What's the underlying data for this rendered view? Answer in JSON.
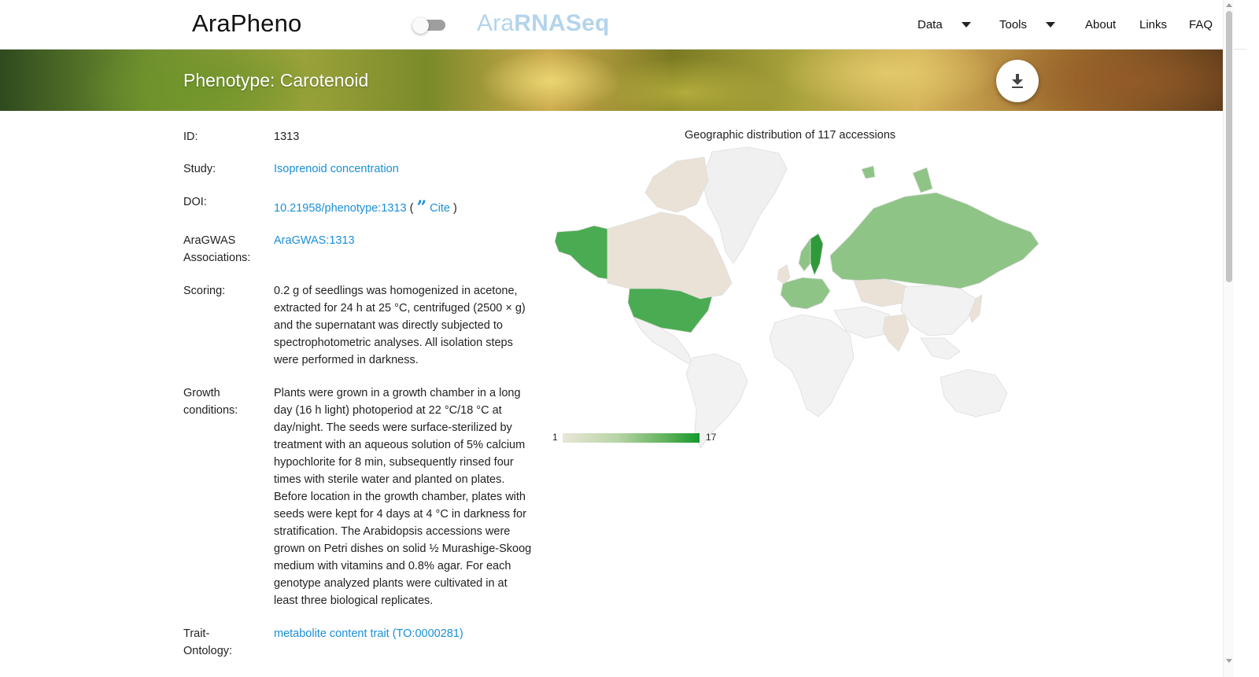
{
  "header": {
    "brand": "AraPheno",
    "rnaseq_a": "Ara",
    "rnaseq_b": "RNASeq",
    "nav": [
      {
        "label": "Data",
        "dropdown": true
      },
      {
        "label": "Tools",
        "dropdown": true
      },
      {
        "label": "About"
      },
      {
        "label": "Links"
      },
      {
        "label": "FAQ"
      }
    ]
  },
  "banner": {
    "title": "Phenotype: Carotenoid",
    "download_icon": "download-icon"
  },
  "details": {
    "id_label": "ID:",
    "id_value": "1313",
    "study_label": "Study:",
    "study_value": "Isoprenoid concentration",
    "doi_label": "DOI:",
    "doi_value": "10.21958/phenotype:1313",
    "doi_open": "(",
    "doi_cite": "Cite",
    "doi_close": ")",
    "aragwas_label": "AraGWAS Associations:",
    "aragwas_value": "AraGWAS:1313",
    "scoring_label": "Scoring:",
    "scoring_value": "0.2 g of seedlings was homogenized in acetone, extracted for 24 h at 25 °C, centrifuged (2500 × g) and the supernatant was directly subjected to spectrophotometric analyses. All isolation steps were performed in darkness.",
    "growth_label": "Growth conditions:",
    "growth_value": "Plants were grown in a growth chamber in a long day (16 h light) photoperiod at 22 °C/18 °C at day/night. The seeds were surface-sterilized by treatment with an aqueous solution of 5% calcium hypochlorite for 8 min, subsequently rinsed four times with sterile water and planted on plates. Before location in the growth chamber, plates with seeds were kept for 4 days at 4 °C in darkness for stratification. The Arabidopsis accessions were grown on Petri dishes on solid ½ Murashige-Skoog medium with vitamins and 0.8% agar. For each genotype analyzed plants were cultivated in at least three biological replicates.",
    "ontology_label": "Trait-Ontology:",
    "ontology_value": "metabolite content trait (TO:0000281)"
  },
  "map": {
    "title": "Geographic distribution of 117 accessions",
    "legend_min": "1",
    "legend_max": "17",
    "colors": {
      "none": "#f2f2f2",
      "low": "#eae2d6",
      "mid": "#8fc487",
      "high": "#4bab52",
      "max": "#2e9a3a"
    }
  },
  "colors": {
    "link": "#1a8fd6",
    "rnaseq": "#b3d4ec"
  }
}
